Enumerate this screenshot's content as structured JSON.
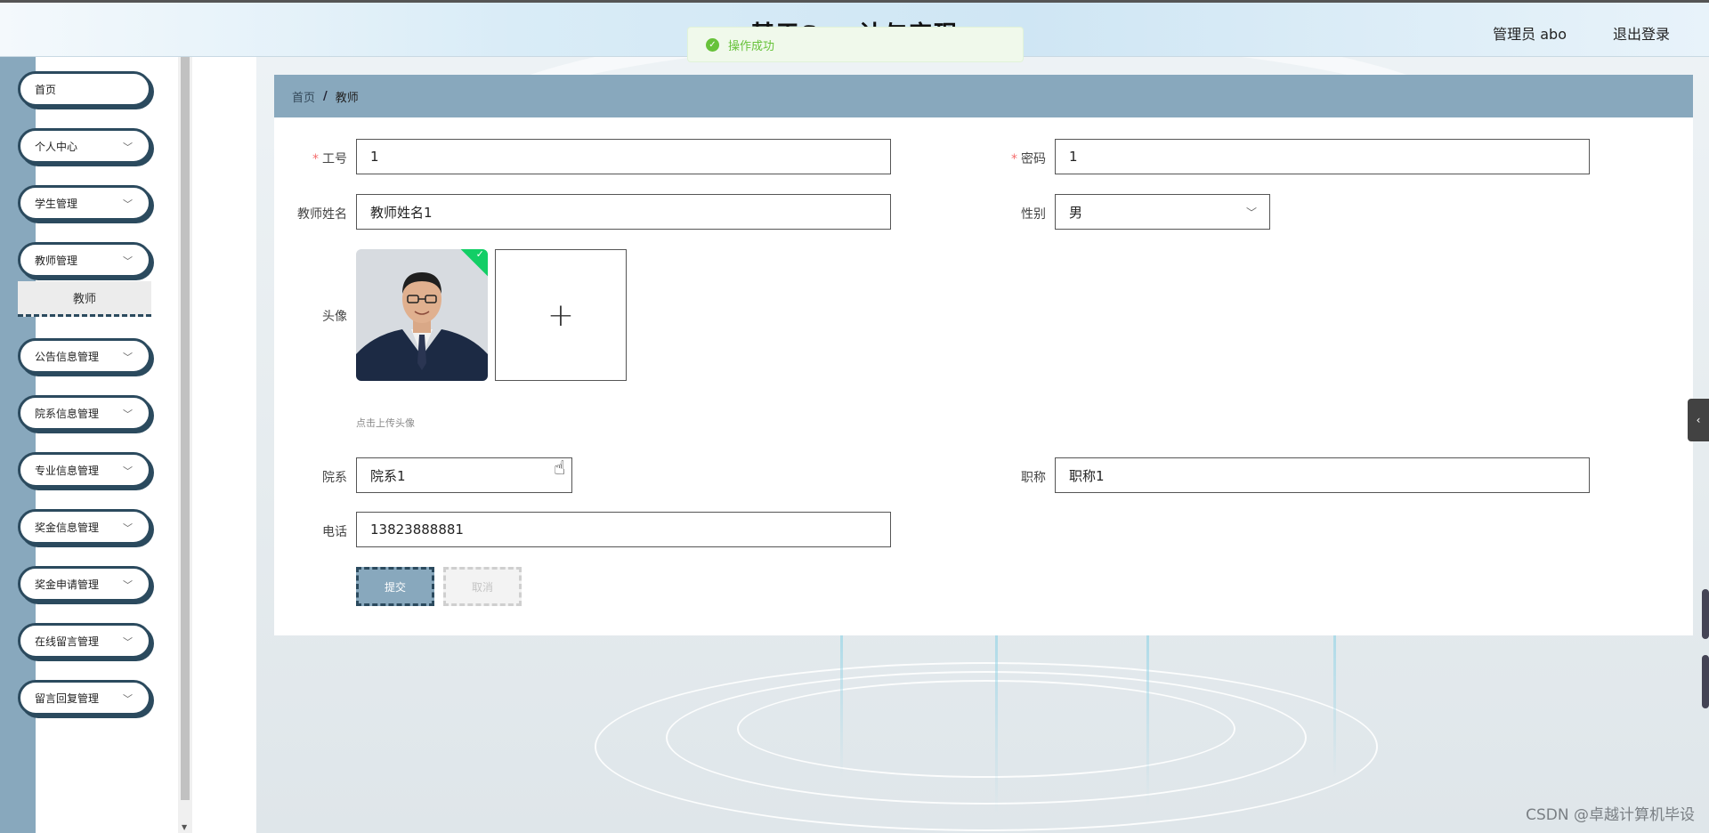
{
  "header": {
    "title": "基于Spr             计与实现",
    "user": "管理员 abo",
    "logout": "退出登录"
  },
  "toast": {
    "message": "操作成功"
  },
  "sidebar": {
    "items": [
      {
        "label": "首页"
      },
      {
        "label": "个人中心"
      },
      {
        "label": "学生管理"
      },
      {
        "label": "教师管理"
      },
      {
        "label": "教师"
      },
      {
        "label": "公告信息管理"
      },
      {
        "label": "院系信息管理"
      },
      {
        "label": "专业信息管理"
      },
      {
        "label": "奖金信息管理"
      },
      {
        "label": "奖金申请管理"
      },
      {
        "label": "在线留言管理"
      },
      {
        "label": "留言回复管理"
      }
    ]
  },
  "breadcrumb": {
    "home": "首页",
    "separator": "/",
    "current": "教师"
  },
  "form": {
    "job_no": {
      "label": "工号",
      "value": "1"
    },
    "password": {
      "label": "密码",
      "value": "1"
    },
    "teacher_name": {
      "label": "教师姓名",
      "value": "教师姓名1"
    },
    "gender": {
      "label": "性别",
      "value": "男"
    },
    "avatar": {
      "label": "头像",
      "tip": "点击上传头像"
    },
    "department": {
      "label": "院系",
      "value": "院系1"
    },
    "title": {
      "label": "职称",
      "value": "职称1"
    },
    "phone": {
      "label": "电话",
      "value": "13823888881"
    },
    "submit": "提交",
    "cancel": "取消"
  },
  "watermark": "CSDN @卓越计算机毕设",
  "colors": {
    "accent": "#88a8bd",
    "dark": "#2b4a5e",
    "success": "#67c23a"
  }
}
